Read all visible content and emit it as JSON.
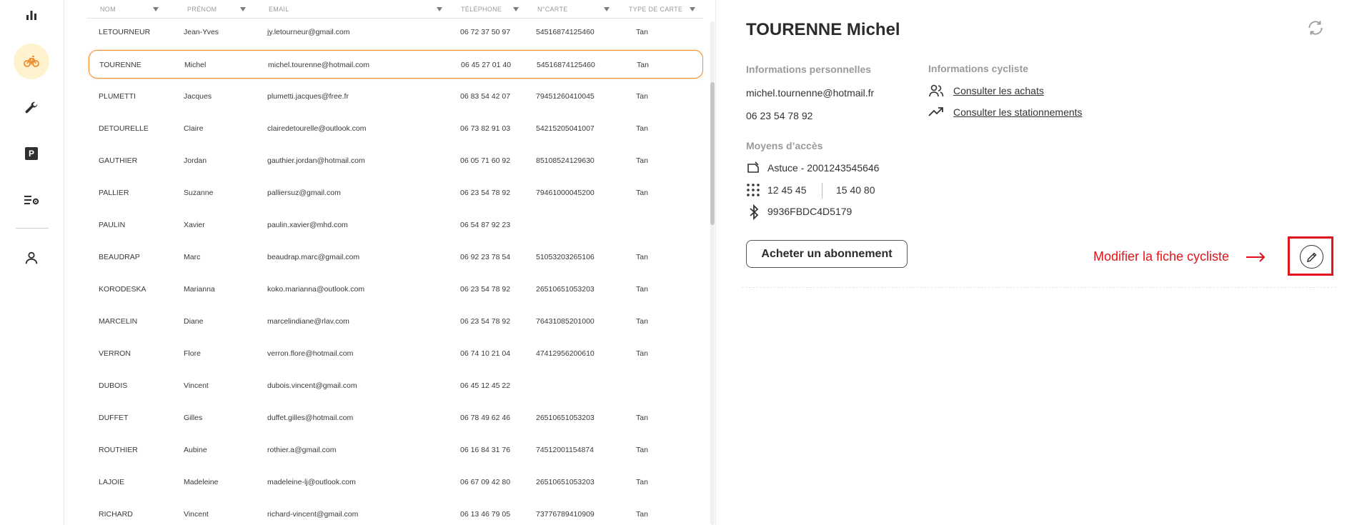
{
  "sidebar": {
    "items": [
      {
        "icon": "bar-chart-icon"
      },
      {
        "icon": "bike-icon",
        "active": true
      },
      {
        "icon": "wrench-icon"
      },
      {
        "icon": "parking-icon",
        "label": "P"
      },
      {
        "icon": "settings-list-icon"
      },
      {
        "icon": "user-icon"
      }
    ]
  },
  "table": {
    "columns": [
      "NOM",
      "PRÉNOM",
      "EMAIL",
      "TÉLÉPHONE",
      "N°CARTE",
      "TYPE DE CARTE"
    ],
    "rows": [
      {
        "nom": "LETOURNEUR",
        "prenom": "Jean-Yves",
        "email": "jy.letourneur@gmail.com",
        "tel": "06 72 37 50 97",
        "carte": "54516874125460",
        "type": "Tan"
      },
      {
        "nom": "TOURENNE",
        "prenom": "Michel",
        "email": "michel.tourenne@hotmail.com",
        "tel": "06 45 27 01 40",
        "carte": "54516874125460",
        "type": "Tan",
        "selected": true
      },
      {
        "nom": "PLUMETTI",
        "prenom": "Jacques",
        "email": "plumetti.jacques@free.fr",
        "tel": "06 83 54 42 07",
        "carte": "79451260410045",
        "type": "Tan"
      },
      {
        "nom": "DETOURELLE",
        "prenom": "Claire",
        "email": "clairedetourelle@outlook.com",
        "tel": "06 73 82 91 03",
        "carte": "54215205041007",
        "type": "Tan"
      },
      {
        "nom": "GAUTHIER",
        "prenom": "Jordan",
        "email": "gauthier.jordan@hotmail.com",
        "tel": "06 05 71 60 92",
        "carte": "85108524129630",
        "type": "Tan"
      },
      {
        "nom": "PALLIER",
        "prenom": "Suzanne",
        "email": "palliersuz@gmail.com",
        "tel": "06 23 54 78 92",
        "carte": "79461000045200",
        "type": "Tan"
      },
      {
        "nom": "PAULIN",
        "prenom": "Xavier",
        "email": "paulin.xavier@mhd.com",
        "tel": "06 54 87 92 23",
        "carte": "",
        "type": ""
      },
      {
        "nom": "BEAUDRAP",
        "prenom": "Marc",
        "email": "beaudrap.marc@gmail.com",
        "tel": "06 92 23 78 54",
        "carte": "51053203265106",
        "type": "Tan"
      },
      {
        "nom": "KORODESKA",
        "prenom": "Marianna",
        "email": "koko.marianna@outlook.com",
        "tel": "06 23 54 78 92",
        "carte": "26510651053203",
        "type": "Tan"
      },
      {
        "nom": "MARCELIN",
        "prenom": "Diane",
        "email": "marcelindiane@rlav.com",
        "tel": "06 23 54 78 92",
        "carte": "76431085201000",
        "type": "Tan"
      },
      {
        "nom": "VERRON",
        "prenom": "Flore",
        "email": "verron.flore@hotmail.com",
        "tel": "06 74 10 21 04",
        "carte": "47412956200610",
        "type": "Tan"
      },
      {
        "nom": "DUBOIS",
        "prenom": "Vincent",
        "email": "dubois.vincent@gmail.com",
        "tel": "06 45 12 45 22",
        "carte": "",
        "type": ""
      },
      {
        "nom": "DUFFET",
        "prenom": "Gilles",
        "email": "duffet.gilles@hotmail.com",
        "tel": "06 78 49 62 46",
        "carte": "26510651053203",
        "type": "Tan"
      },
      {
        "nom": "ROUTHIER",
        "prenom": "Aubine",
        "email": "rothier.a@gmail.com",
        "tel": "06 16 84 31 76",
        "carte": "74512001154874",
        "type": "Tan"
      },
      {
        "nom": "LAJOIE",
        "prenom": "Madeleine",
        "email": "madeleine-lj@outlook.com",
        "tel": "06 67 09 42 80",
        "carte": "26510651053203",
        "type": "Tan"
      },
      {
        "nom": "RICHARD",
        "prenom": "Vincent",
        "email": "richard-vincent@gmail.com",
        "tel": "06 13 46 79 05",
        "carte": "73776789410909",
        "type": "Tan"
      }
    ]
  },
  "detail": {
    "title": "TOURENNE Michel",
    "personal_title": "Informations personnelles",
    "email": "michel.tournenne@hotmail.fr",
    "phone": "06 23 54 78 92",
    "access_title": "Moyens d’accès",
    "card": "Astuce - 2001243545646",
    "code1": "12 45 45",
    "code2": "15 40 80",
    "bluetooth": "9936FBDC4D5179",
    "cyclist_title": "Informations cycliste",
    "link_purchases": "Consulter les achats",
    "link_parkings": "Consulter les stationnements",
    "subscribe_button": "Acheter un abonnement",
    "annotation": "Modifier la fiche cycliste"
  },
  "colors": {
    "accent": "#f08c2a",
    "active_bg": "#fff3cf",
    "annotation": "#e2141b"
  }
}
